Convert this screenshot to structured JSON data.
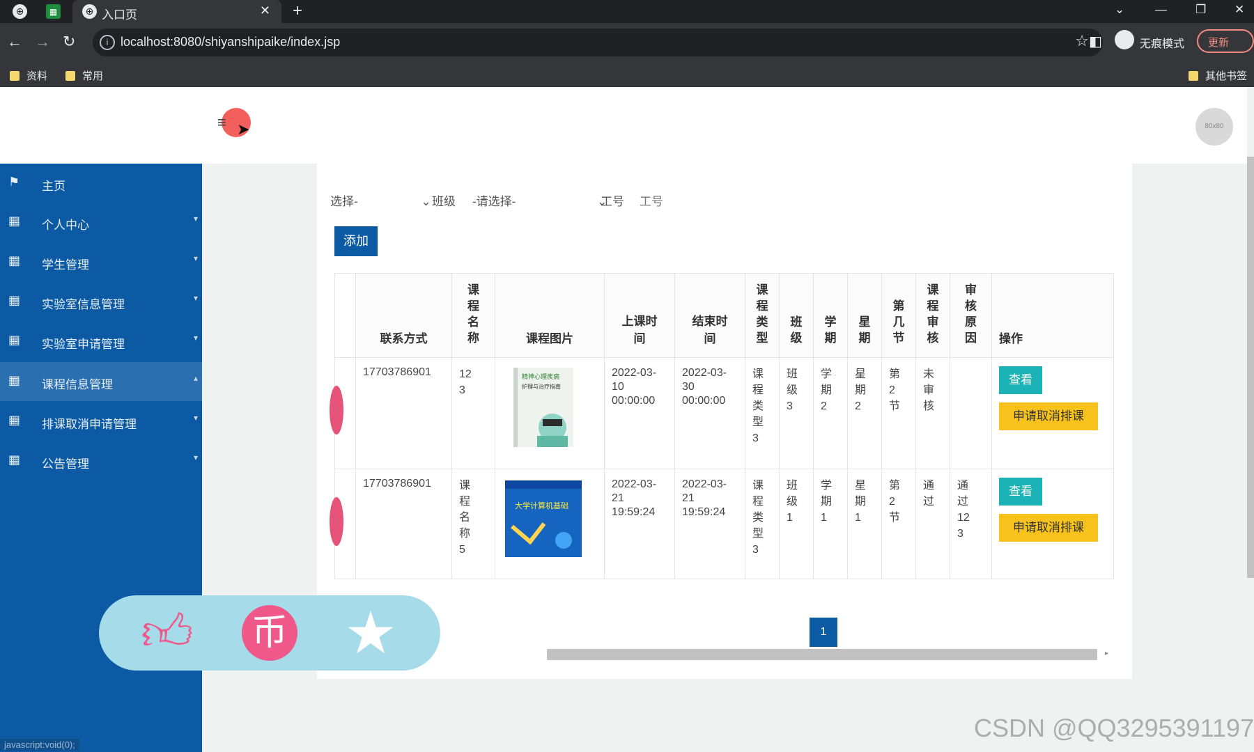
{
  "browser": {
    "tab_title": "入口页",
    "url": "localhost:8080/shiyanshipaike/index.jsp",
    "incognito_label": "无痕模式",
    "update_label": "更新",
    "bookmarks": [
      "资料",
      "常用"
    ],
    "other_bookmarks": "其他书签"
  },
  "header": {
    "avatar_text": "80x80"
  },
  "sidebar": {
    "items": [
      {
        "label": "主页",
        "icon": "flag-icon"
      },
      {
        "label": "个人中心",
        "icon": "grid-icon"
      },
      {
        "label": "学生管理",
        "icon": "grid-icon"
      },
      {
        "label": "实验室信息管理",
        "icon": "grid-icon"
      },
      {
        "label": "实验室申请管理",
        "icon": "grid-icon"
      },
      {
        "label": "课程信息管理",
        "icon": "grid-icon"
      },
      {
        "label": "排课取消申请管理",
        "icon": "grid-icon"
      },
      {
        "label": "公告管理",
        "icon": "grid-icon"
      }
    ],
    "status_text": "javascript:void(0);"
  },
  "filters": {
    "select1_value": "选择-",
    "class_label": "班级",
    "class_value": "-请选择-",
    "staff_label": "工号",
    "staff_placeholder": "工号"
  },
  "add_label": "添加",
  "table": {
    "headers": {
      "contact": "联系方式",
      "course_name": "课程名称",
      "course_image": "课程图片",
      "start_time": "上课时间",
      "end_time": "结束时间",
      "course_type": "课程类型",
      "class": "班级",
      "term": "学期",
      "weekday": "星期",
      "section": "第几节",
      "review": "课程审核",
      "reason": "审核原因",
      "actions": "操作"
    },
    "rows": [
      {
        "contact": "17703786901",
        "course_name": "123",
        "image_title": "精神心理疾病护理与治疗指南",
        "start_time": "2022-03-10 00:00:00",
        "end_time": "2022-03-30 00:00:00",
        "course_type": "课程类型3",
        "class": "班级3",
        "term": "学期2",
        "weekday": "星期2",
        "section": "第2节",
        "review": "未审核",
        "reason": ""
      },
      {
        "contact": "17703786901",
        "course_name": "课程名称5",
        "image_title": "大学计算机基础",
        "start_time": "2022-03-21 19:59:24",
        "end_time": "2022-03-21 19:59:24",
        "course_type": "课程类型3",
        "class": "班级1",
        "term": "学期1",
        "weekday": "星期1",
        "section": "第2节",
        "review": "通过",
        "reason": "通过123"
      }
    ],
    "view_label": "查看",
    "cancel_label": "申请取消排课"
  },
  "pagination": {
    "current": "1"
  },
  "reactions": {
    "like": "like-icon",
    "coin": "coin-icon",
    "favorite": "star-icon",
    "coin_glyph": "币"
  },
  "watermark": "CSDN @QQ3295391197",
  "colors": {
    "sidebar": "#0b5aa3",
    "view_button": "#1ab2b5",
    "cancel_button": "#f6c21b",
    "reaction_bar": "#a6dcea"
  }
}
